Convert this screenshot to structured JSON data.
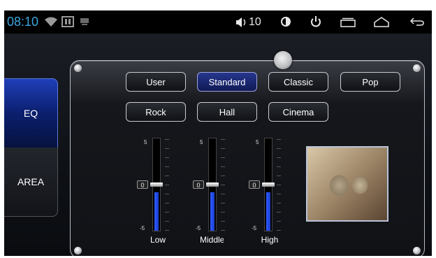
{
  "status_bar": {
    "time": "08:10",
    "volume": "10",
    "colors": {
      "time": "#3aa5e0",
      "icons": "#e8e8e8"
    }
  },
  "side_tabs": [
    {
      "label": "EQ",
      "active": true
    },
    {
      "label": "AREA",
      "active": false
    }
  ],
  "presets": [
    {
      "label": "User",
      "active": false
    },
    {
      "label": "Standard",
      "active": true
    },
    {
      "label": "Classic",
      "active": false
    },
    {
      "label": "Pop",
      "active": false
    },
    {
      "label": "Rock",
      "active": false
    },
    {
      "label": "Hall",
      "active": false
    },
    {
      "label": "Cinema",
      "active": false
    }
  ],
  "eq": {
    "scale_max": "5",
    "scale_min": "-5",
    "bands": [
      {
        "label": "Low",
        "marker": "0",
        "level": 0
      },
      {
        "label": "Middle",
        "marker": "0",
        "level": 0
      },
      {
        "label": "High",
        "marker": "0",
        "level": 0
      }
    ]
  },
  "colors": {
    "accent": "#1a3cd0",
    "active_tab": "#1f3fb8"
  }
}
